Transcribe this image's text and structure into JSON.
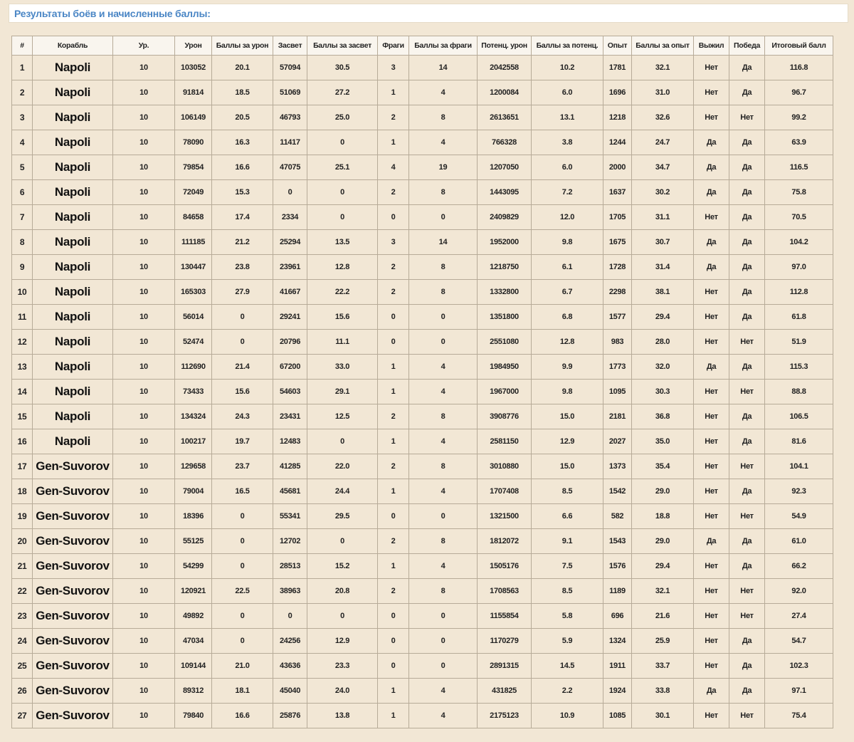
{
  "page": {
    "heading": "Результаты боёв и начисленные баллы:",
    "heading_color": "#4a86c5",
    "background_color": "#f2e7d5"
  },
  "table": {
    "columns": [
      "#",
      "Корабль",
      "Ур.",
      "Урон",
      "Баллы за урон",
      "Засвет",
      "Баллы за засвет",
      "Фраги",
      "Баллы за фраги",
      "Потенц. урон",
      "Баллы за потенц.",
      "Опыт",
      "Баллы за опыт",
      "Выжил",
      "Победа",
      "Итоговый балл"
    ],
    "rows": [
      [
        "1",
        "Napoli",
        "10",
        "103052",
        "20.1",
        "57094",
        "30.5",
        "3",
        "14",
        "2042558",
        "10.2",
        "1781",
        "32.1",
        "Нет",
        "Да",
        "116.8"
      ],
      [
        "2",
        "Napoli",
        "10",
        "91814",
        "18.5",
        "51069",
        "27.2",
        "1",
        "4",
        "1200084",
        "6.0",
        "1696",
        "31.0",
        "Нет",
        "Да",
        "96.7"
      ],
      [
        "3",
        "Napoli",
        "10",
        "106149",
        "20.5",
        "46793",
        "25.0",
        "2",
        "8",
        "2613651",
        "13.1",
        "1218",
        "32.6",
        "Нет",
        "Нет",
        "99.2"
      ],
      [
        "4",
        "Napoli",
        "10",
        "78090",
        "16.3",
        "11417",
        "0",
        "1",
        "4",
        "766328",
        "3.8",
        "1244",
        "24.7",
        "Да",
        "Да",
        "63.9"
      ],
      [
        "5",
        "Napoli",
        "10",
        "79854",
        "16.6",
        "47075",
        "25.1",
        "4",
        "19",
        "1207050",
        "6.0",
        "2000",
        "34.7",
        "Да",
        "Да",
        "116.5"
      ],
      [
        "6",
        "Napoli",
        "10",
        "72049",
        "15.3",
        "0",
        "0",
        "2",
        "8",
        "1443095",
        "7.2",
        "1637",
        "30.2",
        "Да",
        "Да",
        "75.8"
      ],
      [
        "7",
        "Napoli",
        "10",
        "84658",
        "17.4",
        "2334",
        "0",
        "0",
        "0",
        "2409829",
        "12.0",
        "1705",
        "31.1",
        "Нет",
        "Да",
        "70.5"
      ],
      [
        "8",
        "Napoli",
        "10",
        "111185",
        "21.2",
        "25294",
        "13.5",
        "3",
        "14",
        "1952000",
        "9.8",
        "1675",
        "30.7",
        "Да",
        "Да",
        "104.2"
      ],
      [
        "9",
        "Napoli",
        "10",
        "130447",
        "23.8",
        "23961",
        "12.8",
        "2",
        "8",
        "1218750",
        "6.1",
        "1728",
        "31.4",
        "Да",
        "Да",
        "97.0"
      ],
      [
        "10",
        "Napoli",
        "10",
        "165303",
        "27.9",
        "41667",
        "22.2",
        "2",
        "8",
        "1332800",
        "6.7",
        "2298",
        "38.1",
        "Нет",
        "Да",
        "112.8"
      ],
      [
        "11",
        "Napoli",
        "10",
        "56014",
        "0",
        "29241",
        "15.6",
        "0",
        "0",
        "1351800",
        "6.8",
        "1577",
        "29.4",
        "Нет",
        "Да",
        "61.8"
      ],
      [
        "12",
        "Napoli",
        "10",
        "52474",
        "0",
        "20796",
        "11.1",
        "0",
        "0",
        "2551080",
        "12.8",
        "983",
        "28.0",
        "Нет",
        "Нет",
        "51.9"
      ],
      [
        "13",
        "Napoli",
        "10",
        "112690",
        "21.4",
        "67200",
        "33.0",
        "1",
        "4",
        "1984950",
        "9.9",
        "1773",
        "32.0",
        "Да",
        "Да",
        "115.3"
      ],
      [
        "14",
        "Napoli",
        "10",
        "73433",
        "15.6",
        "54603",
        "29.1",
        "1",
        "4",
        "1967000",
        "9.8",
        "1095",
        "30.3",
        "Нет",
        "Нет",
        "88.8"
      ],
      [
        "15",
        "Napoli",
        "10",
        "134324",
        "24.3",
        "23431",
        "12.5",
        "2",
        "8",
        "3908776",
        "15.0",
        "2181",
        "36.8",
        "Нет",
        "Да",
        "106.5"
      ],
      [
        "16",
        "Napoli",
        "10",
        "100217",
        "19.7",
        "12483",
        "0",
        "1",
        "4",
        "2581150",
        "12.9",
        "2027",
        "35.0",
        "Нет",
        "Да",
        "81.6"
      ],
      [
        "17",
        "Gen-Suvorov",
        "10",
        "129658",
        "23.7",
        "41285",
        "22.0",
        "2",
        "8",
        "3010880",
        "15.0",
        "1373",
        "35.4",
        "Нет",
        "Нет",
        "104.1"
      ],
      [
        "18",
        "Gen-Suvorov",
        "10",
        "79004",
        "16.5",
        "45681",
        "24.4",
        "1",
        "4",
        "1707408",
        "8.5",
        "1542",
        "29.0",
        "Нет",
        "Да",
        "92.3"
      ],
      [
        "19",
        "Gen-Suvorov",
        "10",
        "18396",
        "0",
        "55341",
        "29.5",
        "0",
        "0",
        "1321500",
        "6.6",
        "582",
        "18.8",
        "Нет",
        "Нет",
        "54.9"
      ],
      [
        "20",
        "Gen-Suvorov",
        "10",
        "55125",
        "0",
        "12702",
        "0",
        "2",
        "8",
        "1812072",
        "9.1",
        "1543",
        "29.0",
        "Да",
        "Да",
        "61.0"
      ],
      [
        "21",
        "Gen-Suvorov",
        "10",
        "54299",
        "0",
        "28513",
        "15.2",
        "1",
        "4",
        "1505176",
        "7.5",
        "1576",
        "29.4",
        "Нет",
        "Да",
        "66.2"
      ],
      [
        "22",
        "Gen-Suvorov",
        "10",
        "120921",
        "22.5",
        "38963",
        "20.8",
        "2",
        "8",
        "1708563",
        "8.5",
        "1189",
        "32.1",
        "Нет",
        "Нет",
        "92.0"
      ],
      [
        "23",
        "Gen-Suvorov",
        "10",
        "49892",
        "0",
        "0",
        "0",
        "0",
        "0",
        "1155854",
        "5.8",
        "696",
        "21.6",
        "Нет",
        "Нет",
        "27.4"
      ],
      [
        "24",
        "Gen-Suvorov",
        "10",
        "47034",
        "0",
        "24256",
        "12.9",
        "0",
        "0",
        "1170279",
        "5.9",
        "1324",
        "25.9",
        "Нет",
        "Да",
        "54.7"
      ],
      [
        "25",
        "Gen-Suvorov",
        "10",
        "109144",
        "21.0",
        "43636",
        "23.3",
        "0",
        "0",
        "2891315",
        "14.5",
        "1911",
        "33.7",
        "Нет",
        "Да",
        "102.3"
      ],
      [
        "26",
        "Gen-Suvorov",
        "10",
        "89312",
        "18.1",
        "45040",
        "24.0",
        "1",
        "4",
        "431825",
        "2.2",
        "1924",
        "33.8",
        "Да",
        "Да",
        "97.1"
      ],
      [
        "27",
        "Gen-Suvorov",
        "10",
        "79840",
        "16.6",
        "25876",
        "13.8",
        "1",
        "4",
        "2175123",
        "10.9",
        "1085",
        "30.1",
        "Нет",
        "Нет",
        "75.4"
      ]
    ]
  }
}
